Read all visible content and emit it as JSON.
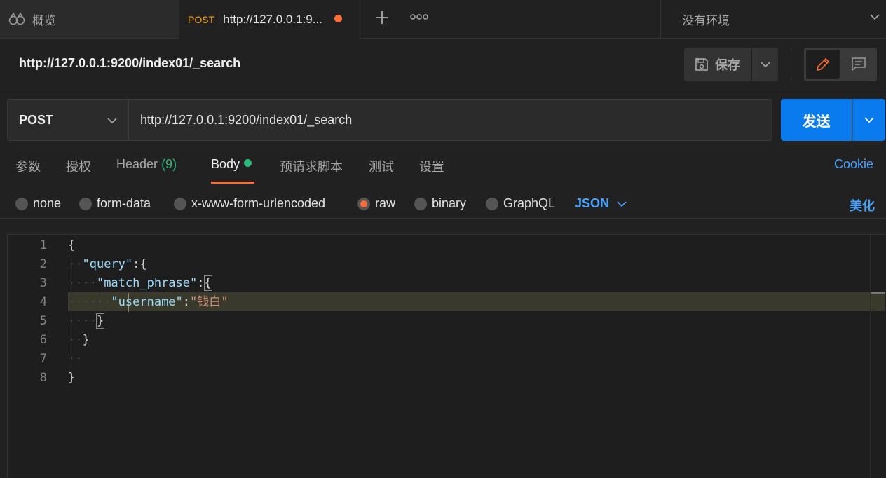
{
  "tabs": {
    "overview_label": "概览",
    "active_method": "POST",
    "active_url": "http://127.0.0.1:9...",
    "environment": "没有环境"
  },
  "request": {
    "title": "http://127.0.0.1:9200/index01/_search",
    "save_label": "保存",
    "method": "POST",
    "url": "http://127.0.0.1:9200/index01/_search",
    "send_label": "发送"
  },
  "subtabs": {
    "params": "参数",
    "auth": "授权",
    "header": "Header",
    "header_count": "(9)",
    "body": "Body",
    "prerequest": "预请求脚本",
    "tests": "测试",
    "settings": "设置",
    "cookie": "Cookie"
  },
  "body_types": {
    "none": "none",
    "form_data": "form-data",
    "urlencoded": "x-www-form-urlencoded",
    "raw": "raw",
    "binary": "binary",
    "graphql": "GraphQL",
    "selected": "raw",
    "language": "JSON",
    "beautify": "美化"
  },
  "editor": {
    "line_numbers": [
      "1",
      "2",
      "3",
      "4",
      "5",
      "6",
      "7",
      "8"
    ],
    "l1_open": "{",
    "l2_key": "\"query\"",
    "l2_colon": ":",
    "l2_open": "{",
    "l3_key": "\"match_phrase\"",
    "l3_colon": ":",
    "l3_open": "{",
    "l4_key": "\"username\"",
    "l4_colon": ":",
    "l4_value": "\"钱白\"",
    "l5_close": "}",
    "l6_close": "}",
    "l8_close": "}"
  },
  "colors": {
    "accent": "#ff6c37",
    "send_button": "#097bed",
    "link": "#4aa3ff",
    "method_tab": "#f5a623",
    "body_dot": "#2fb67c"
  }
}
